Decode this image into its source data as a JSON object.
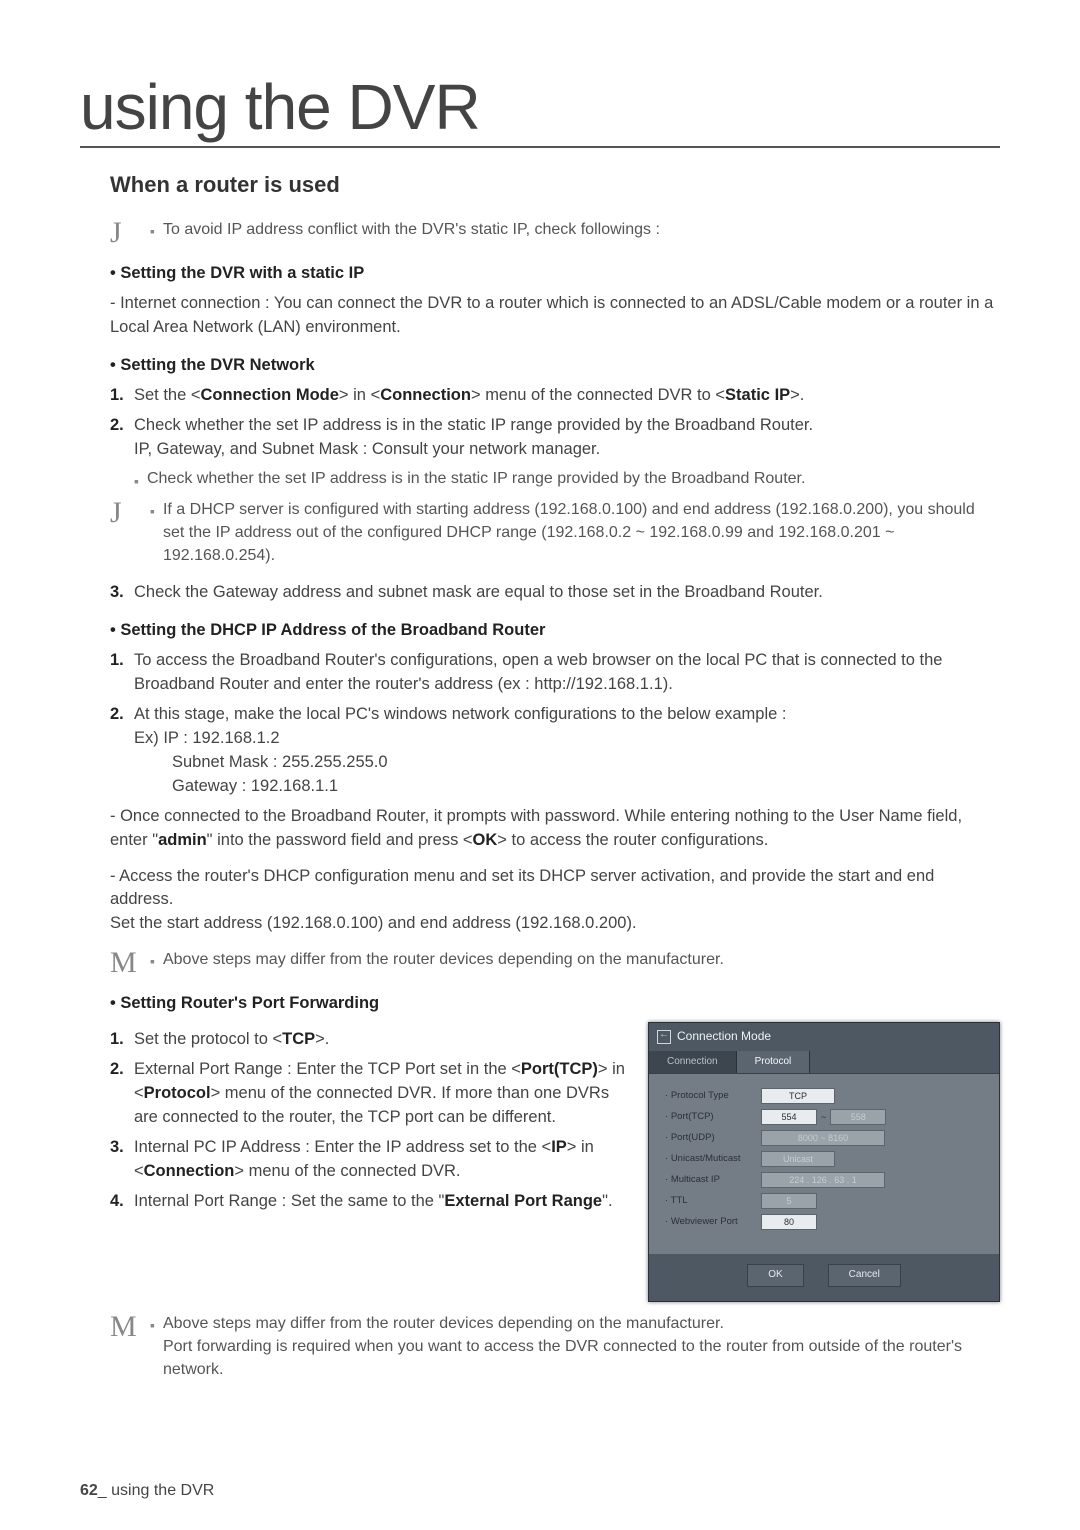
{
  "chapter_title": "using the DVR",
  "section_title": "When a router is used",
  "j1_text": "To avoid IP address conflict with the DVR's static IP, check followings :",
  "h1": "• Setting the DVR with a static IP",
  "p1": "- Internet connection : You can connect the DVR to a router which is connected to an ADSL/Cable modem or a router in a Local Area Network (LAN) environment.",
  "h2": "• Setting the DVR Network",
  "ol1_pre": "Set the <",
  "ol1_b1": "Connection Mode",
  "ol1_mid": "> in <",
  "ol1_b2": "Connection",
  "ol1_post": "> menu of the connected DVR to <",
  "ol1_b3": "Static IP",
  "ol1_end": ">.",
  "ol2_l1": "Check whether the set IP address is in the static IP range provided by the Broadband Router.",
  "ol2_l2": "IP, Gateway, and Subnet Mask : Consult your network manager.",
  "sub_bullet_1": "Check whether the set IP address is in the static IP range provided by the Broadband Router.",
  "j2_text": "If a DHCP server is configured with starting address (192.168.0.100) and end address (192.168.0.200), you should set the IP address out of the configured DHCP range (192.168.0.2 ~ 192.168.0.99 and 192.168.0.201 ~ 192.168.0.254).",
  "ol3": "Check the Gateway address and subnet mask are equal to those set in the Broadband Router.",
  "h3": "• Setting the DHCP IP Address of the Broadband Router",
  "olb1": "To access the Broadband Router's configurations, open a web browser on the local PC that is connected to the Broadband Router and enter the router's address (ex : http://192.168.1.1).",
  "olb2_l1": "At this stage, make the local PC's windows network configurations to the below example :",
  "olb2_l2": "Ex) IP : 192.168.1.2",
  "olb2_l3": "Subnet Mask : 255.255.255.0",
  "olb2_l4": "Gateway : 192.168.1.1",
  "p_conn_pre": "- Once connected to the Broadband Router, it prompts with password. While entering nothing to the User Name field, enter \"",
  "p_conn_b1": "admin",
  "p_conn_mid": "\" into the password field and press <",
  "p_conn_b2": "OK",
  "p_conn_post": "> to access the router configurations.",
  "p_dhcp1": "- Access the router's DHCP configuration menu and set its DHCP server activation, and provide the start and end address.",
  "p_dhcp2": "Set the start address (192.168.0.100) and end address (192.168.0.200).",
  "m1_text": "Above steps may differ from the router devices depending on the manufacturer.",
  "h4": "• Setting Router's Port Forwarding",
  "pf1_pre": "Set the protocol to <",
  "pf1_b": "TCP",
  "pf1_post": ">.",
  "pf2_pre": "External Port Range : Enter the TCP Port set in the <",
  "pf2_b1": "Port(TCP)",
  "pf2_mid": "> in <",
  "pf2_b2": "Protocol",
  "pf2_post": "> menu of the connected DVR. If more than one DVRs are connected to the router, the TCP port can be different.",
  "pf3_pre": "Internal PC IP Address : Enter the IP address set to the <",
  "pf3_b1": "IP",
  "pf3_mid": "> in <",
  "pf3_b2": "Connection",
  "pf3_post": "> menu of the connected DVR.",
  "pf4_pre": "Internal Port Range : Set the same to the \"",
  "pf4_b": "External Port Range",
  "pf4_post": "\".",
  "m2_l1": "Above steps may differ from the router devices depending on the manufacturer.",
  "m2_l2": "Port forwarding is required when you want to access the DVR connected to the router from outside of the router's network.",
  "dialog": {
    "title": "Connection Mode",
    "tabs": {
      "t1": "Connection",
      "t2": "Protocol"
    },
    "labels": {
      "protocol_type": "Protocol Type",
      "port_tcp": "Port(TCP)",
      "port_udp": "Port(UDP)",
      "unicast": "Unicast/Muticast",
      "multicast_ip": "Multicast IP",
      "ttl": "TTL",
      "web_port": "Webviewer Port"
    },
    "values": {
      "protocol_type": "TCP",
      "tcp_a": "554",
      "tcp_b": "558",
      "udp": "8000 ~ 8160",
      "unicast": "Unicast",
      "mip": "224 . 126 . 63 .    1",
      "ttl": "5",
      "web_port": "80"
    },
    "buttons": {
      "ok": "OK",
      "cancel": "Cancel"
    }
  },
  "footer": {
    "page": "62",
    "underscore": "_",
    "text": " using the DVR"
  }
}
